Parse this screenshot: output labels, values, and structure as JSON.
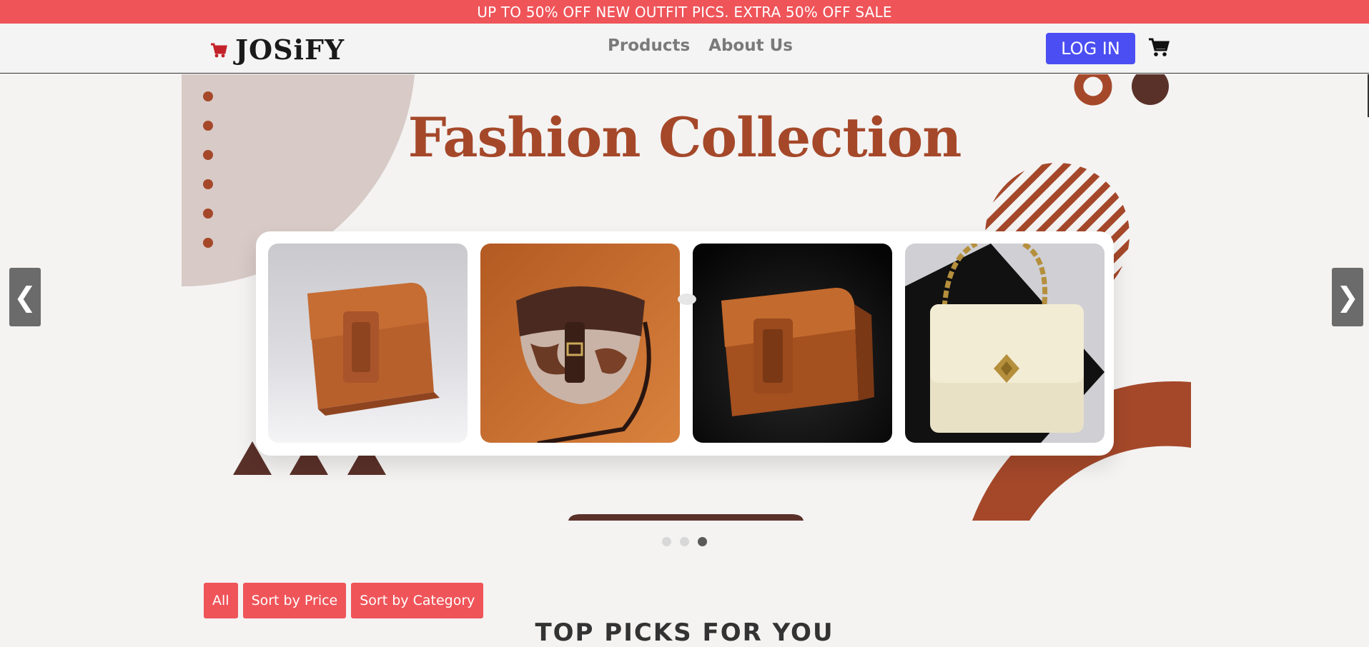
{
  "promo": {
    "text": "UP TO 50% OFF NEW OUTFIT PICS.  EXTRA 50% OFF SALE"
  },
  "nav": {
    "logo_text": "JOSiFY",
    "links": [
      "Products",
      "About Us"
    ],
    "login_label": "LOG IN"
  },
  "hero": {
    "title": "Fashion Collection",
    "slides": [
      "tan-leather-crossbody-bag",
      "cowhide-saddle-bag",
      "tan-bag-on-black",
      "cream-chain-handbag"
    ],
    "prev_label": "❮",
    "next_label": "❯",
    "current_slide": 3,
    "total_slides": 3
  },
  "filters": [
    "All",
    "Sort by Price",
    "Sort by Category"
  ],
  "section": {
    "title": "TOP PICKS FOR YOU"
  },
  "colors": {
    "promo": "#ef5459",
    "login": "#4b4ef2",
    "rust": "#a5482a",
    "brown": "#5a3129",
    "filter": "#ef5459"
  }
}
